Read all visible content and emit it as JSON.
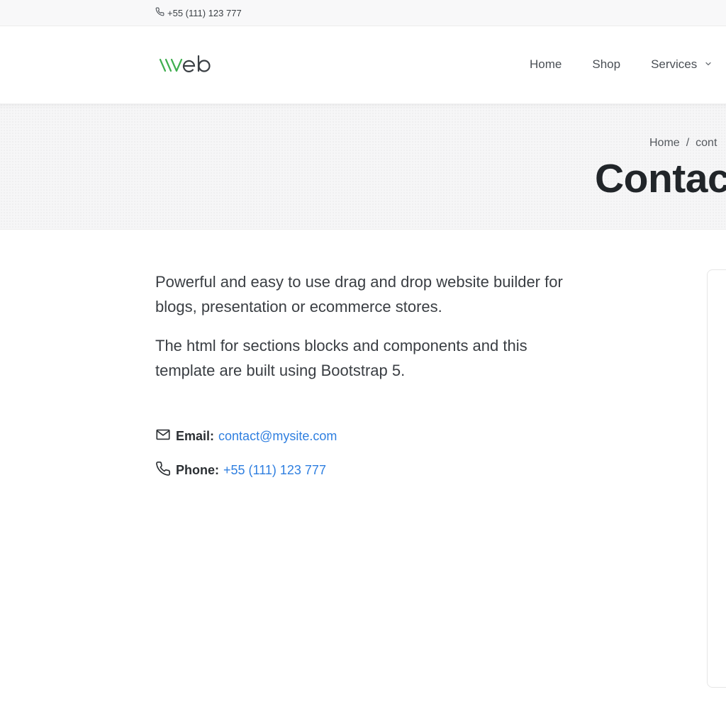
{
  "topbar": {
    "phone": "+55 (111) 123 777",
    "phone_icon": "phone-icon"
  },
  "header": {
    "logo_alt": "vvveb",
    "logo_colors": {
      "accent": "#3fae4f",
      "text": "#3a3f44"
    },
    "nav": [
      {
        "label": "Home"
      },
      {
        "label": "Shop"
      },
      {
        "label": "Services",
        "has_dropdown": true
      }
    ]
  },
  "hero": {
    "breadcrumb": [
      "Home",
      "/",
      "cont"
    ],
    "title": "Contac"
  },
  "main": {
    "paragraphs": [
      "Powerful and easy to use drag and drop website builder for blogs, presentation or ecommerce stores.",
      "The html for sections blocks and components and this template are built using Bootstrap 5."
    ],
    "email": {
      "icon": "envelope-icon",
      "label": "Email:",
      "value": "contact@mysite.com"
    },
    "phone": {
      "icon": "phone-icon",
      "label": "Phone:",
      "value": "+55 (111) 123 777"
    }
  },
  "colors": {
    "link": "#2f7fe0",
    "title": "#212529",
    "hero_bg": "#f6f6f7"
  }
}
